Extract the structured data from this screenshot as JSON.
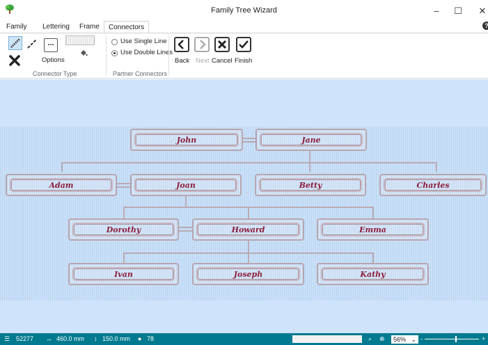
{
  "window": {
    "title": "Family Tree Wizard",
    "minimize": "–",
    "maximize": "☐",
    "close": "✕"
  },
  "tabs": [
    {
      "label": "Family",
      "active": false
    },
    {
      "label": "Lettering",
      "active": false
    },
    {
      "label": "Frame",
      "active": false
    },
    {
      "label": "Connectors",
      "active": true
    }
  ],
  "help_icon": "?",
  "ribbon": {
    "connector_type": {
      "group_label": "Connector Type",
      "options_label": "Options",
      "options_glyph": "..."
    },
    "partner_connectors": {
      "group_label": "Partner Connectors",
      "single_line_label": "Use Single Line",
      "double_lines_label": "Use Double Lines",
      "selected": "double"
    },
    "nav": {
      "back": "Back",
      "next": "Next",
      "cancel": "Cancel",
      "finish": "Finish"
    }
  },
  "tree": {
    "generation1": [
      "John",
      "Jane"
    ],
    "generation2": [
      "Adam",
      "Joan",
      "Betty",
      "Charles"
    ],
    "generation3": [
      "Dorothy",
      "Howard",
      "Emma"
    ],
    "generation4": [
      "Ivan",
      "Joseph",
      "Kathy"
    ]
  },
  "status": {
    "stitches": "52277",
    "width": "460.0 mm",
    "height": "150.0 mm",
    "colors": "78",
    "zoom": "56%",
    "zoom_out": "-",
    "zoom_in": "+"
  }
}
